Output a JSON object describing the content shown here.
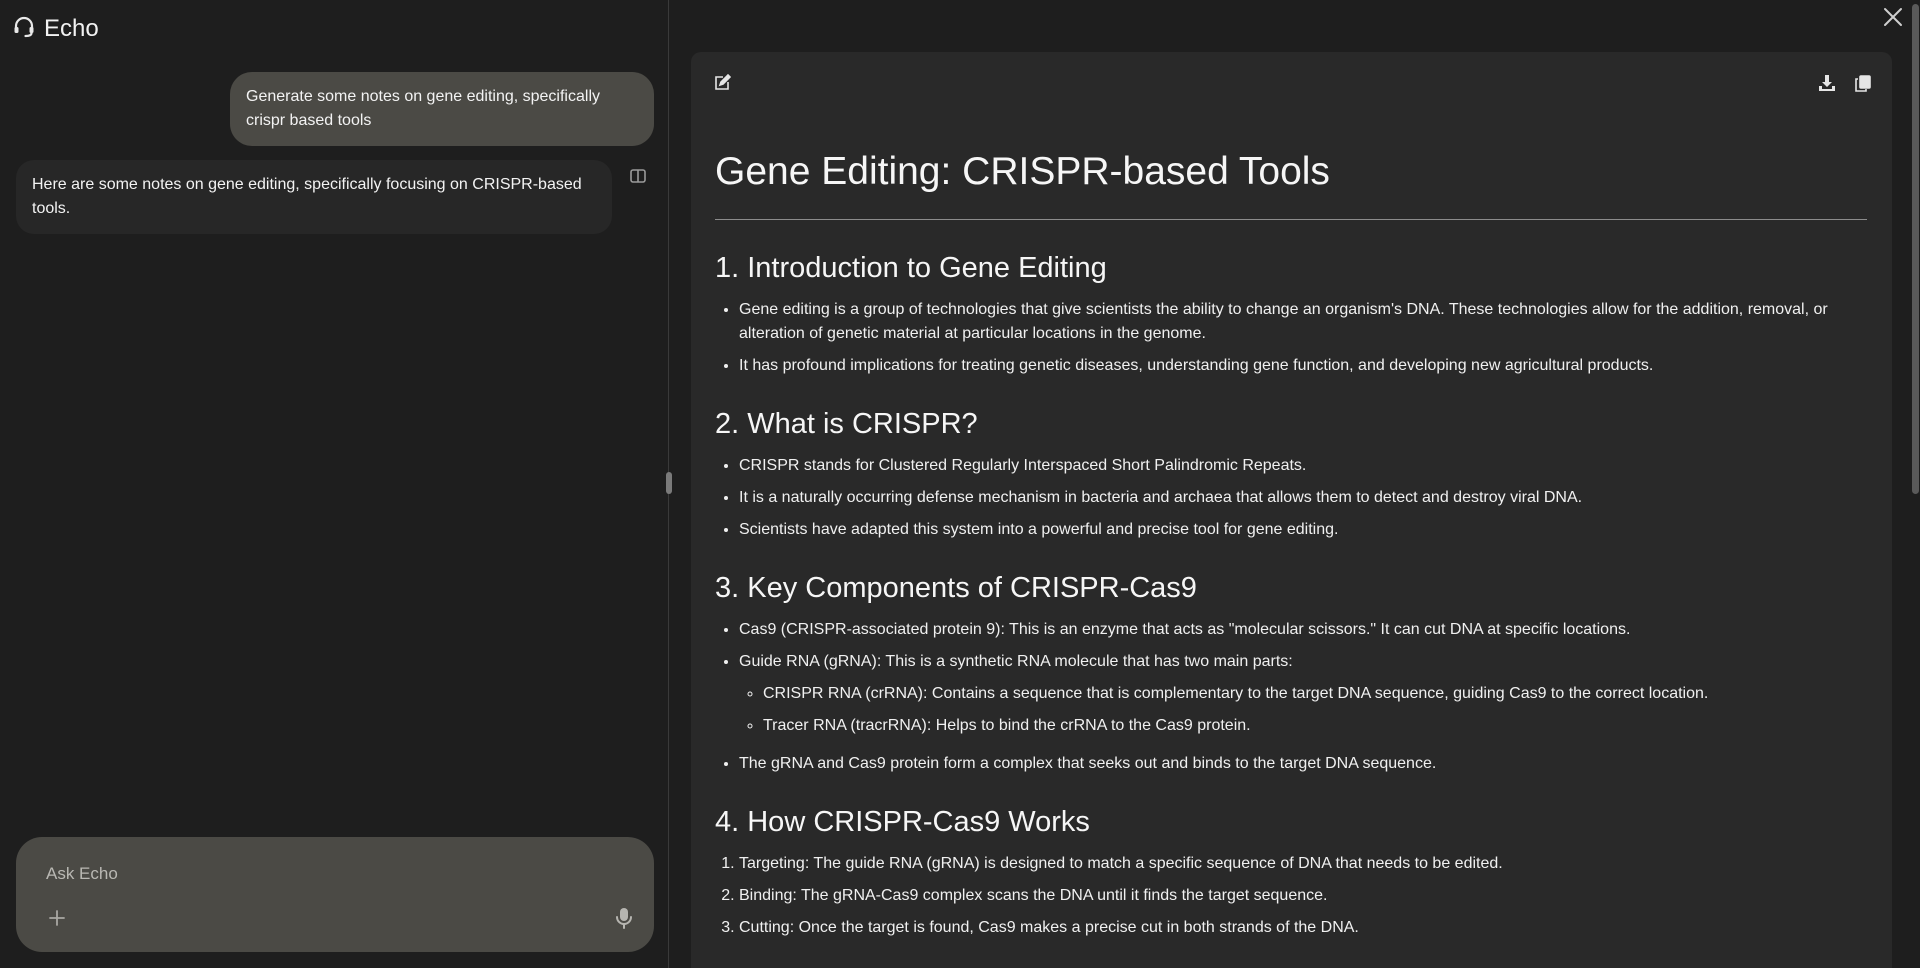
{
  "app": {
    "title": "Echo",
    "logo_icon": "headset-icon"
  },
  "chat": {
    "user_message": "Generate some notes on gene editing, specifically crispr based tools",
    "assistant_message": "Here are some notes on gene editing, specifically focusing on CRISPR-based tools."
  },
  "composer": {
    "placeholder": "Ask Echo"
  },
  "doc": {
    "title": "Gene Editing: CRISPR-based Tools",
    "sections": {
      "s1": {
        "heading": "1. Introduction to Gene Editing",
        "items": [
          "Gene editing is a group of technologies that give scientists the ability to change an organism's DNA. These technologies allow for the addition, removal, or alteration of genetic material at particular locations in the genome.",
          "It has profound implications for treating genetic diseases, understanding gene function, and developing new agricultural products."
        ]
      },
      "s2": {
        "heading": "2. What is CRISPR?",
        "items": [
          "CRISPR stands for Clustered Regularly Interspaced Short Palindromic Repeats.",
          "It is a naturally occurring defense mechanism in bacteria and archaea that allows them to detect and destroy viral DNA.",
          "Scientists have adapted this system into a powerful and precise tool for gene editing."
        ]
      },
      "s3": {
        "heading": "3. Key Components of CRISPR-Cas9",
        "items": [
          "Cas9 (CRISPR-associated protein 9): This is an enzyme that acts as \"molecular scissors.\" It can cut DNA at specific locations.",
          "Guide RNA (gRNA): This is a synthetic RNA molecule that has two main parts:",
          "The gRNA and Cas9 protein form a complex that seeks out and binds to the target DNA sequence."
        ],
        "subitems": [
          "CRISPR RNA (crRNA): Contains a sequence that is complementary to the target DNA sequence, guiding Cas9 to the correct location.",
          "Tracer RNA (tracrRNA): Helps to bind the crRNA to the Cas9 protein."
        ]
      },
      "s4": {
        "heading": "4. How CRISPR-Cas9 Works",
        "items": [
          "Targeting: The guide RNA (gRNA) is designed to match a specific sequence of DNA that needs to be edited.",
          "Binding: The gRNA-Cas9 complex scans the DNA until it finds the target sequence.",
          "Cutting: Once the target is found, Cas9 makes a precise cut in both strands of the DNA."
        ]
      }
    }
  },
  "icons": [
    "headset-icon",
    "split-view-icon",
    "plus-icon",
    "mic-icon",
    "close-icon",
    "edit-icon",
    "download-icon",
    "copy-icon"
  ]
}
